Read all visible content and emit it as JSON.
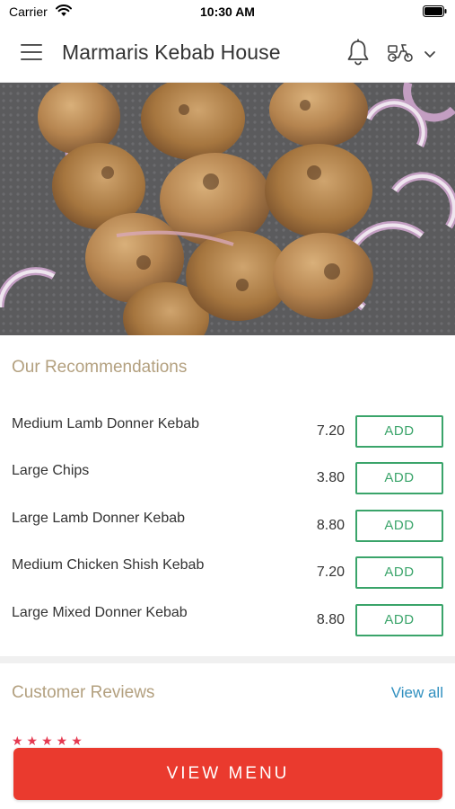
{
  "status_bar": {
    "carrier": "Carrier",
    "time": "10:30 AM",
    "wifi_icon": "wifi-icon",
    "battery_icon": "battery-icon"
  },
  "header": {
    "title": "Marmaris Kebab House",
    "menu_icon": "hamburger-menu-icon",
    "bell_icon": "bell-icon",
    "delivery_icon": "scooter-icon",
    "dropdown_icon": "chevron-down-icon"
  },
  "hero": {
    "image": "kebab-skewers-photo"
  },
  "recommendations": {
    "title": "Our Recommendations",
    "items": [
      {
        "name": "Medium Lamb Donner Kebab",
        "price": "7.20",
        "button": "ADD"
      },
      {
        "name": "Large Chips",
        "price": "3.80",
        "button": "ADD"
      },
      {
        "name": "Large Lamb Donner Kebab",
        "price": "8.80",
        "button": "ADD"
      },
      {
        "name": "Medium Chicken Shish Kebab",
        "price": "7.20",
        "button": "ADD"
      },
      {
        "name": "Large Mixed Donner Kebab",
        "price": "8.80",
        "button": "ADD"
      }
    ]
  },
  "reviews": {
    "title": "Customer Reviews",
    "view_all": "View all",
    "stars": "★★★★★"
  },
  "footer": {
    "view_menu": "VIEW MENU"
  },
  "colors": {
    "accent_gold": "#b3a07f",
    "add_green": "#3aa46a",
    "link_blue": "#2f8fbf",
    "cta_red": "#ea3a2e",
    "star_pink": "#e53950"
  }
}
